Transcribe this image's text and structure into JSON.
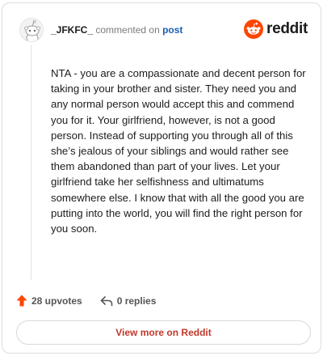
{
  "comment": {
    "username": "_JFKFC_",
    "action_text": "commented on",
    "post_link": "post",
    "body": "NTA - you are a compassionate and decent person for taking in your brother and sister. They need you and any normal person would accept this and commend you for it. Your girlfriend, however, is not a good person. Instead of supporting you through all of this she’s jealous of your siblings and would rather see them abandoned than part of your lives. Let your girlfriend take her selfishness and ultimatums somewhere else. I know that with all the good you are putting into the world, you will find the right person for you soon."
  },
  "brand": {
    "wordmark": "reddit",
    "color": "#ff4500"
  },
  "actions": {
    "upvotes": "28 upvotes",
    "replies": "0 replies",
    "upvote_icon": "upvote-arrow-icon",
    "reply_icon": "reply-arrow-icon"
  },
  "view_more": {
    "label": "View more on Reddit",
    "color": "#c0392b"
  }
}
